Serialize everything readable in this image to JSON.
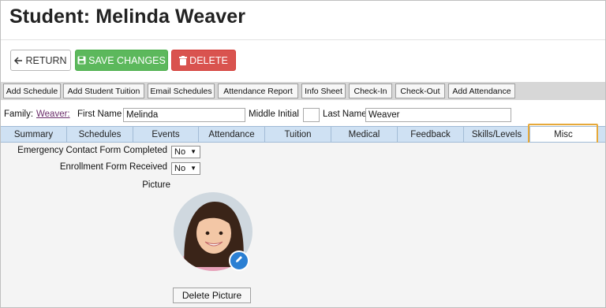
{
  "header": {
    "title": "Student: Melinda Weaver"
  },
  "actions": {
    "return_label": "RETURN",
    "save_label": "SAVE CHANGES",
    "delete_label": "DELETE"
  },
  "toolbar": [
    "Add Schedule",
    "Add Student Tuition",
    "Email Schedules",
    "Attendance Report",
    "Info Sheet",
    "Check-In",
    "Check-Out",
    "Add Attendance"
  ],
  "student": {
    "family_label": "Family:",
    "family_value": "Weaver:",
    "first_name_label": "First Name",
    "first_name": "Melinda",
    "middle_initial_label": "Middle Initial",
    "middle_initial": "",
    "last_name_label": "Last Name",
    "last_name": "Weaver"
  },
  "tabs": [
    "Summary",
    "Schedules",
    "Events",
    "Attendance",
    "Tuition",
    "Medical",
    "Feedback",
    "Skills/Levels",
    "Misc"
  ],
  "active_tab": "Misc",
  "misc": {
    "emergency_label": "Emergency Contact Form Completed",
    "emergency_value": "No",
    "enrollment_label": "Enrollment Form Received",
    "enrollment_value": "No",
    "picture_label": "Picture",
    "delete_picture_label": "Delete Picture"
  },
  "colors": {
    "save": "#5cb85c",
    "delete": "#d9534f",
    "tab_bar": "#cfe1f3",
    "highlight": "#e6a93a",
    "family_link": "#6b2d6b",
    "edit_badge": "#2a7fd3"
  },
  "icons": {
    "return": "arrow-left-icon",
    "save": "floppy-disk-icon",
    "delete": "trash-icon",
    "edit": "pencil-icon"
  }
}
